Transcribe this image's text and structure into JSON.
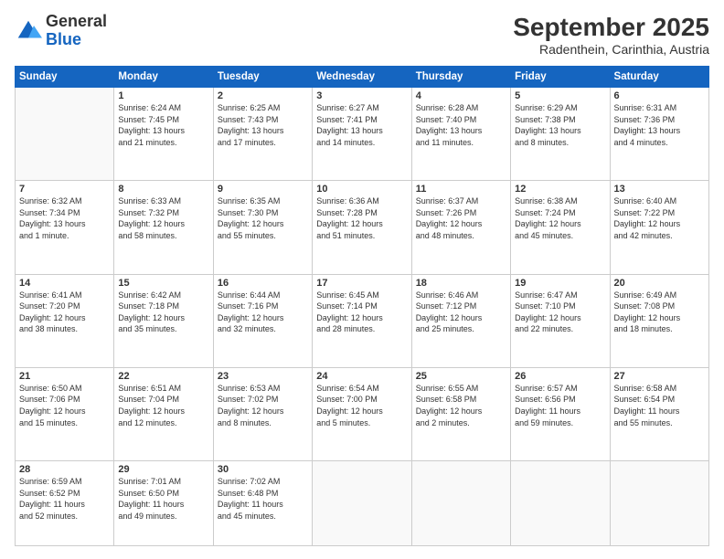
{
  "header": {
    "logo_general": "General",
    "logo_blue": "Blue",
    "title": "September 2025",
    "subtitle": "Radenthein, Carinthia, Austria"
  },
  "weekdays": [
    "Sunday",
    "Monday",
    "Tuesday",
    "Wednesday",
    "Thursday",
    "Friday",
    "Saturday"
  ],
  "weeks": [
    [
      {
        "day": "",
        "info": ""
      },
      {
        "day": "1",
        "info": "Sunrise: 6:24 AM\nSunset: 7:45 PM\nDaylight: 13 hours\nand 21 minutes."
      },
      {
        "day": "2",
        "info": "Sunrise: 6:25 AM\nSunset: 7:43 PM\nDaylight: 13 hours\nand 17 minutes."
      },
      {
        "day": "3",
        "info": "Sunrise: 6:27 AM\nSunset: 7:41 PM\nDaylight: 13 hours\nand 14 minutes."
      },
      {
        "day": "4",
        "info": "Sunrise: 6:28 AM\nSunset: 7:40 PM\nDaylight: 13 hours\nand 11 minutes."
      },
      {
        "day": "5",
        "info": "Sunrise: 6:29 AM\nSunset: 7:38 PM\nDaylight: 13 hours\nand 8 minutes."
      },
      {
        "day": "6",
        "info": "Sunrise: 6:31 AM\nSunset: 7:36 PM\nDaylight: 13 hours\nand 4 minutes."
      }
    ],
    [
      {
        "day": "7",
        "info": "Sunrise: 6:32 AM\nSunset: 7:34 PM\nDaylight: 13 hours\nand 1 minute."
      },
      {
        "day": "8",
        "info": "Sunrise: 6:33 AM\nSunset: 7:32 PM\nDaylight: 12 hours\nand 58 minutes."
      },
      {
        "day": "9",
        "info": "Sunrise: 6:35 AM\nSunset: 7:30 PM\nDaylight: 12 hours\nand 55 minutes."
      },
      {
        "day": "10",
        "info": "Sunrise: 6:36 AM\nSunset: 7:28 PM\nDaylight: 12 hours\nand 51 minutes."
      },
      {
        "day": "11",
        "info": "Sunrise: 6:37 AM\nSunset: 7:26 PM\nDaylight: 12 hours\nand 48 minutes."
      },
      {
        "day": "12",
        "info": "Sunrise: 6:38 AM\nSunset: 7:24 PM\nDaylight: 12 hours\nand 45 minutes."
      },
      {
        "day": "13",
        "info": "Sunrise: 6:40 AM\nSunset: 7:22 PM\nDaylight: 12 hours\nand 42 minutes."
      }
    ],
    [
      {
        "day": "14",
        "info": "Sunrise: 6:41 AM\nSunset: 7:20 PM\nDaylight: 12 hours\nand 38 minutes."
      },
      {
        "day": "15",
        "info": "Sunrise: 6:42 AM\nSunset: 7:18 PM\nDaylight: 12 hours\nand 35 minutes."
      },
      {
        "day": "16",
        "info": "Sunrise: 6:44 AM\nSunset: 7:16 PM\nDaylight: 12 hours\nand 32 minutes."
      },
      {
        "day": "17",
        "info": "Sunrise: 6:45 AM\nSunset: 7:14 PM\nDaylight: 12 hours\nand 28 minutes."
      },
      {
        "day": "18",
        "info": "Sunrise: 6:46 AM\nSunset: 7:12 PM\nDaylight: 12 hours\nand 25 minutes."
      },
      {
        "day": "19",
        "info": "Sunrise: 6:47 AM\nSunset: 7:10 PM\nDaylight: 12 hours\nand 22 minutes."
      },
      {
        "day": "20",
        "info": "Sunrise: 6:49 AM\nSunset: 7:08 PM\nDaylight: 12 hours\nand 18 minutes."
      }
    ],
    [
      {
        "day": "21",
        "info": "Sunrise: 6:50 AM\nSunset: 7:06 PM\nDaylight: 12 hours\nand 15 minutes."
      },
      {
        "day": "22",
        "info": "Sunrise: 6:51 AM\nSunset: 7:04 PM\nDaylight: 12 hours\nand 12 minutes."
      },
      {
        "day": "23",
        "info": "Sunrise: 6:53 AM\nSunset: 7:02 PM\nDaylight: 12 hours\nand 8 minutes."
      },
      {
        "day": "24",
        "info": "Sunrise: 6:54 AM\nSunset: 7:00 PM\nDaylight: 12 hours\nand 5 minutes."
      },
      {
        "day": "25",
        "info": "Sunrise: 6:55 AM\nSunset: 6:58 PM\nDaylight: 12 hours\nand 2 minutes."
      },
      {
        "day": "26",
        "info": "Sunrise: 6:57 AM\nSunset: 6:56 PM\nDaylight: 11 hours\nand 59 minutes."
      },
      {
        "day": "27",
        "info": "Sunrise: 6:58 AM\nSunset: 6:54 PM\nDaylight: 11 hours\nand 55 minutes."
      }
    ],
    [
      {
        "day": "28",
        "info": "Sunrise: 6:59 AM\nSunset: 6:52 PM\nDaylight: 11 hours\nand 52 minutes."
      },
      {
        "day": "29",
        "info": "Sunrise: 7:01 AM\nSunset: 6:50 PM\nDaylight: 11 hours\nand 49 minutes."
      },
      {
        "day": "30",
        "info": "Sunrise: 7:02 AM\nSunset: 6:48 PM\nDaylight: 11 hours\nand 45 minutes."
      },
      {
        "day": "",
        "info": ""
      },
      {
        "day": "",
        "info": ""
      },
      {
        "day": "",
        "info": ""
      },
      {
        "day": "",
        "info": ""
      }
    ]
  ]
}
